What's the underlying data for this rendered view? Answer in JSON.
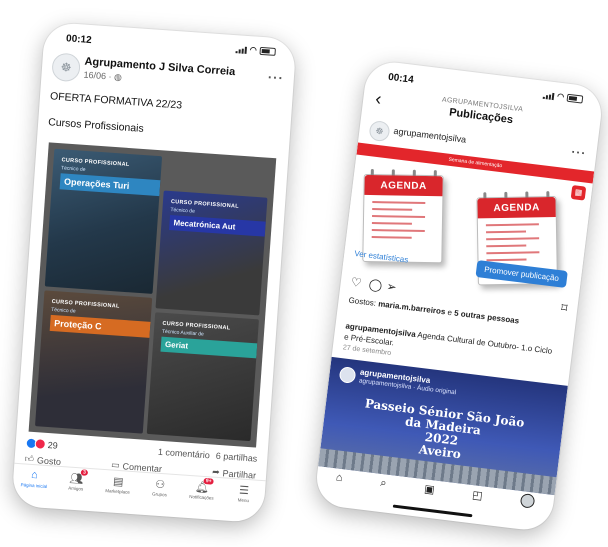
{
  "facebook": {
    "status_time": "00:12",
    "page_name": "Agrupamento J Silva Correia",
    "post_date": "16/06 · ",
    "post_title": "OFERTA FORMATIVA 22/23",
    "post_subtitle": "Cursos Profissionais",
    "tiles": [
      {
        "tag": "CURSO PROFISSIONAL",
        "sub": "Técnico de",
        "name": "Operações Turi",
        "color": "#2e86c1"
      },
      {
        "tag": "CURSO PROFISSIONAL",
        "sub": "Técnico de",
        "name": "Mecatrónica Aut",
        "color": "#2737a6"
      },
      {
        "tag": "CURSO PROFISSIONAL",
        "sub": "Técnico de",
        "name": "Proteção C",
        "color": "#d66b22"
      },
      {
        "tag": "CURSO PROFISSIONAL",
        "sub": "Técnico Auxiliar de",
        "name": "Geriat",
        "color": "#2aa39a"
      }
    ],
    "reaction_count": "29",
    "comment_count": "1 comentário",
    "share_count": "6 partilhas",
    "actions": {
      "like": "Gosto",
      "comment": "Comentar",
      "share": "Partilhar"
    },
    "nav": [
      {
        "label": "Página inicial",
        "icon": "home-icon",
        "active": true
      },
      {
        "label": "Amigos",
        "icon": "friends-icon",
        "badge": "3"
      },
      {
        "label": "Marketplace",
        "icon": "marketplace-icon"
      },
      {
        "label": "Grupos",
        "icon": "groups-icon"
      },
      {
        "label": "Notificações",
        "icon": "bell-icon",
        "badge": "9+"
      },
      {
        "label": "Menu",
        "icon": "menu-icon"
      }
    ]
  },
  "instagram": {
    "status_time": "00:14",
    "account_caption": "AGRUPAMENTOJSILVA",
    "screen_title": "Publicações",
    "username": "agrupamentojsilva",
    "banner_text": "Semana de alimentação",
    "calendar_label": "AGENDA",
    "stats_link": "Ver estatísticas",
    "promote_label": "Promover publicação",
    "likes_prefix": "Gostos: ",
    "likes_user": "maria.m.barreiros",
    "likes_mid": " e ",
    "likes_others": "5 outras pessoas",
    "caption_user": "agrupamentojsilva",
    "caption_text": " Agenda Cultural de Outubro- 1.o Ciclo e Pré-Escolar.",
    "caption_date": "27 de setembro",
    "reel_user": "agrupamentojsilva",
    "reel_audio": "agrupamentojsilva · Áudio original",
    "reel_title_lines": [
      "Passeio Sénior São João",
      "da Madeira",
      "2022",
      "Aveiro"
    ]
  },
  "colors": {
    "facebook_blue": "#1877f2",
    "instagram_blue": "#2e7fd6",
    "agenda_red": "#d9262c"
  }
}
